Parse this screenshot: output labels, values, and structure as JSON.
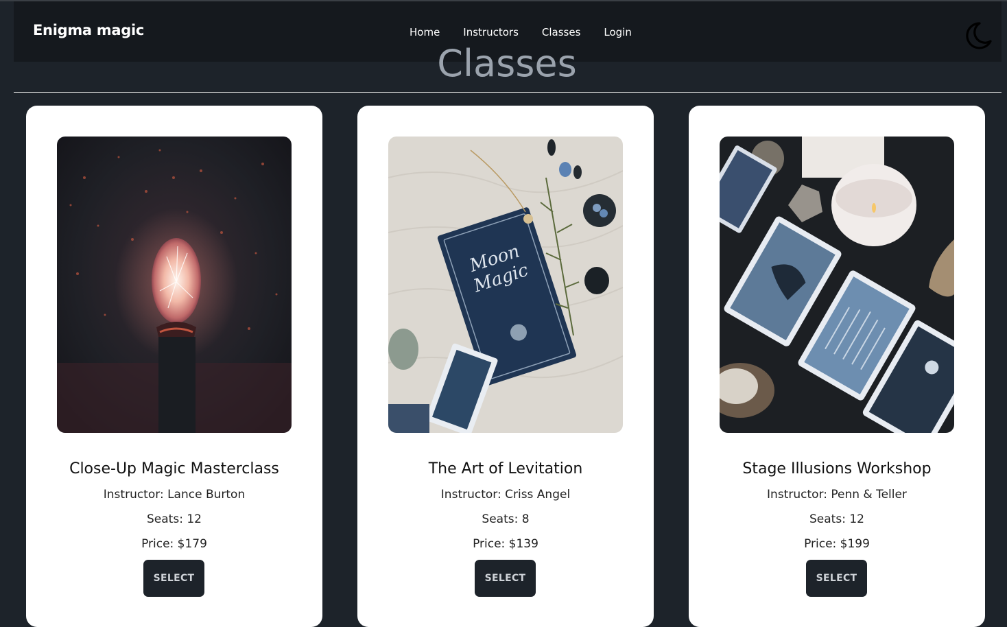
{
  "navbar": {
    "brand": "Enigma magic",
    "menu": [
      "Home",
      "Instructors",
      "Classes",
      "Login"
    ],
    "theme_icon": "moon-icon"
  },
  "page": {
    "title": "Classes"
  },
  "classes": [
    {
      "name": "Close-Up Magic Masterclass",
      "instructor": "Instructor: Lance Burton",
      "seats": "Seats: 12",
      "price": "Price: $179",
      "button": "SELECT",
      "image": "plasma-ball-photo"
    },
    {
      "name": "The Art of Levitation",
      "instructor": "Instructor: Criss Angel",
      "seats": "Seats: 8",
      "price": "Price: $139",
      "button": "SELECT",
      "image": "moon-magic-book-photo"
    },
    {
      "name": "Stage Illusions Workshop",
      "instructor": "Instructor: Penn & Teller",
      "seats": "Seats: 12",
      "price": "Price: $199",
      "button": "SELECT",
      "image": "tarot-cards-candle-photo"
    }
  ],
  "colors": {
    "background": "#1d232a",
    "navbar": "#15191e",
    "card": "#ffffff",
    "button": "#1d232a",
    "title": "#9ba3ad"
  }
}
